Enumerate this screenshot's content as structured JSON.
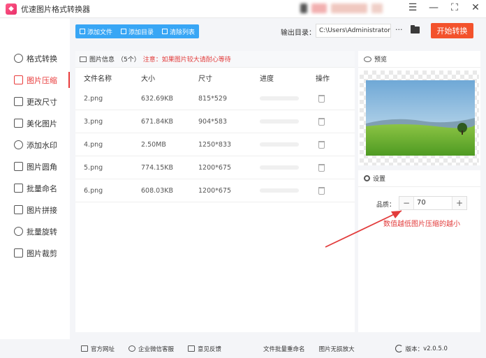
{
  "window": {
    "title": "优速图片格式转换器"
  },
  "sidebar": {
    "items": [
      {
        "label": "格式转换",
        "icon": "format-convert-icon"
      },
      {
        "label": "图片压缩",
        "icon": "compress-icon",
        "active": true
      },
      {
        "label": "更改尺寸",
        "icon": "resize-icon"
      },
      {
        "label": "美化图片",
        "icon": "beautify-icon"
      },
      {
        "label": "添加水印",
        "icon": "watermark-icon"
      },
      {
        "label": "图片圆角",
        "icon": "round-corner-icon"
      },
      {
        "label": "批量命名",
        "icon": "rename-icon"
      },
      {
        "label": "图片拼接",
        "icon": "stitch-icon"
      },
      {
        "label": "批量旋转",
        "icon": "rotate-icon"
      },
      {
        "label": "图片裁剪",
        "icon": "crop-icon"
      }
    ]
  },
  "toolbar": {
    "add_file": "添加文件",
    "add_dir": "添加目录",
    "clear_list": "清除列表",
    "output_label": "输出目录：",
    "output_path": "C:\\Users\\Administrator",
    "more": "···",
    "start": "开始转换"
  },
  "file_panel": {
    "title": "图片信息",
    "count": "（5个）",
    "warning": "注意：如果图片较大请耐心等待",
    "columns": {
      "name": "文件名称",
      "size": "大小",
      "dim": "尺寸",
      "progress": "进度",
      "op": "操作"
    },
    "rows": [
      {
        "name": "2.png",
        "size": "632.69KB",
        "dim": "815*529"
      },
      {
        "name": "3.png",
        "size": "671.84KB",
        "dim": "904*583"
      },
      {
        "name": "4.png",
        "size": "2.50MB",
        "dim": "1250*833"
      },
      {
        "name": "5.png",
        "size": "774.15KB",
        "dim": "1200*675"
      },
      {
        "name": "6.png",
        "size": "608.03KB",
        "dim": "1200*675"
      }
    ]
  },
  "preview": {
    "title": "预览"
  },
  "settings": {
    "title": "设置",
    "quality_label": "品质：",
    "quality_value": "70",
    "minus": "−",
    "plus": "+",
    "hint": "数值越低图片压缩的越小"
  },
  "footer": {
    "website": "官方网址",
    "wechat": "企业微信客服",
    "feedback": "意见反馈",
    "batch_rename": "文件批量重命名",
    "lossless": "图片无损放大",
    "version_label": "版本：",
    "version": "v2.0.5.0"
  },
  "colors": {
    "accent": "#f3522c",
    "active": "#e93b3b",
    "toolbar": "#38a6f5"
  }
}
